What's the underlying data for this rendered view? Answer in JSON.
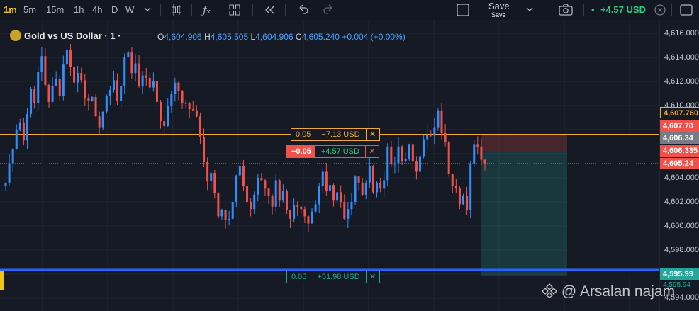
{
  "toolbar": {
    "timeframes": [
      "1m",
      "5m",
      "15m",
      "1h",
      "4h",
      "D",
      "W"
    ],
    "active_timeframe": "1m",
    "save_label": "Save",
    "save_sub_label": "Save",
    "pnl": "+4.57 USD"
  },
  "legend": {
    "symbol": "Gold vs US Dollar · 1 ·",
    "open_label": "O",
    "open": "4,604.906",
    "high_label": "H",
    "high": "4,605.505",
    "low_label": "L",
    "low": "4,604.906",
    "close_label": "C",
    "close": "4,605.240",
    "change": "+0.004 (+0.00%)"
  },
  "price_axis": {
    "ticks": [
      "4,616.000",
      "4,614.000",
      "4,612.000",
      "4,610.000",
      "4,604.000",
      "4,602.000",
      "4,600.000",
      "4,598.000",
      "4,594.000"
    ],
    "tags": {
      "alert": "4,607.760",
      "stop": "4,607.70",
      "entry_hi": "4,606.34",
      "entry": "4,606.335",
      "current": "4,605.24",
      "take_profit": "4,595.99",
      "tp_low": "4,595.94"
    }
  },
  "orders": {
    "stop": {
      "qty": "0.05",
      "pnl": "−7.13 USD",
      "close": "✕"
    },
    "position": {
      "qty": "−0.05",
      "pnl": "+4.57 USD",
      "close": "✕"
    },
    "take_profit": {
      "qty": "0.05",
      "pnl": "+51.98 USD",
      "close": "✕"
    }
  },
  "watermark": "@ Arsalan najam",
  "colors": {
    "bull": "#2f8fff",
    "bear": "#f0524b",
    "profit": "#26a69a",
    "accent": "#f0c419"
  },
  "chart_data": {
    "type": "candlestick",
    "symbol": "Gold vs US Dollar",
    "timeframe": "1",
    "ylim": [
      4594,
      4617
    ],
    "closes": [
      4603.6,
      4605.2,
      4606.4,
      4608.0,
      4608.6,
      4607.1,
      4609.3,
      4611.4,
      4610.2,
      4612.8,
      4614.1,
      4611.7,
      4610.3,
      4611.6,
      4612.2,
      4610.8,
      4613.4,
      4614.6,
      4613.2,
      4611.9,
      4612.7,
      4612.1,
      4610.6,
      4610.4,
      4610.7,
      4609.1,
      4608.2,
      4609.5,
      4610.8,
      4611.3,
      4612.1,
      4610.4,
      4611.6,
      4614.0,
      4614.4,
      4612.7,
      4613.5,
      4611.6,
      4612.5,
      4612.3,
      4611.5,
      4612.0,
      4610.3,
      4608.7,
      4608.3,
      4610.0,
      4611.0,
      4611.9,
      4611.2,
      4610.2,
      4610.2,
      4609.7,
      4609.6,
      4609.1,
      4607.4,
      4605.3,
      4603.7,
      4604.4,
      4602.7,
      4600.8,
      4601.3,
      4600.5,
      4600.6,
      4602.0,
      4604.2,
      4605.0,
      4603.3,
      4602.0,
      4601.4,
      4602.6,
      4604.0,
      4603.8,
      4603.1,
      4602.5,
      4601.6,
      4603.8,
      4602.1,
      4602.9,
      4601.3,
      4600.6,
      4601.7,
      4601.6,
      4601.4,
      4600.8,
      4600.2,
      4601.2,
      4601.8,
      4603.3,
      4604.5,
      4602.9,
      4603.4,
      4602.1,
      4602.8,
      4602.0,
      4600.6,
      4601.4,
      4602.0,
      4604.1,
      4603.6,
      4602.6,
      4603.6,
      4605.0,
      4602.8,
      4603.6,
      4603.1,
      4603.8,
      4606.6,
      4605.1,
      4605.2,
      4606.6,
      4605.4,
      4605.6,
      4606.8,
      4605.4,
      4604.5,
      4605.8,
      4607.2,
      4607.6,
      4607.5,
      4608.2,
      4609.6,
      4607.7,
      4607.0,
      4604.3,
      4603.3,
      4603.1,
      4601.8,
      4602.5,
      4601.3,
      4605.2,
      4606.8,
      4606.6,
      4605.5,
      4605.2
    ]
  }
}
